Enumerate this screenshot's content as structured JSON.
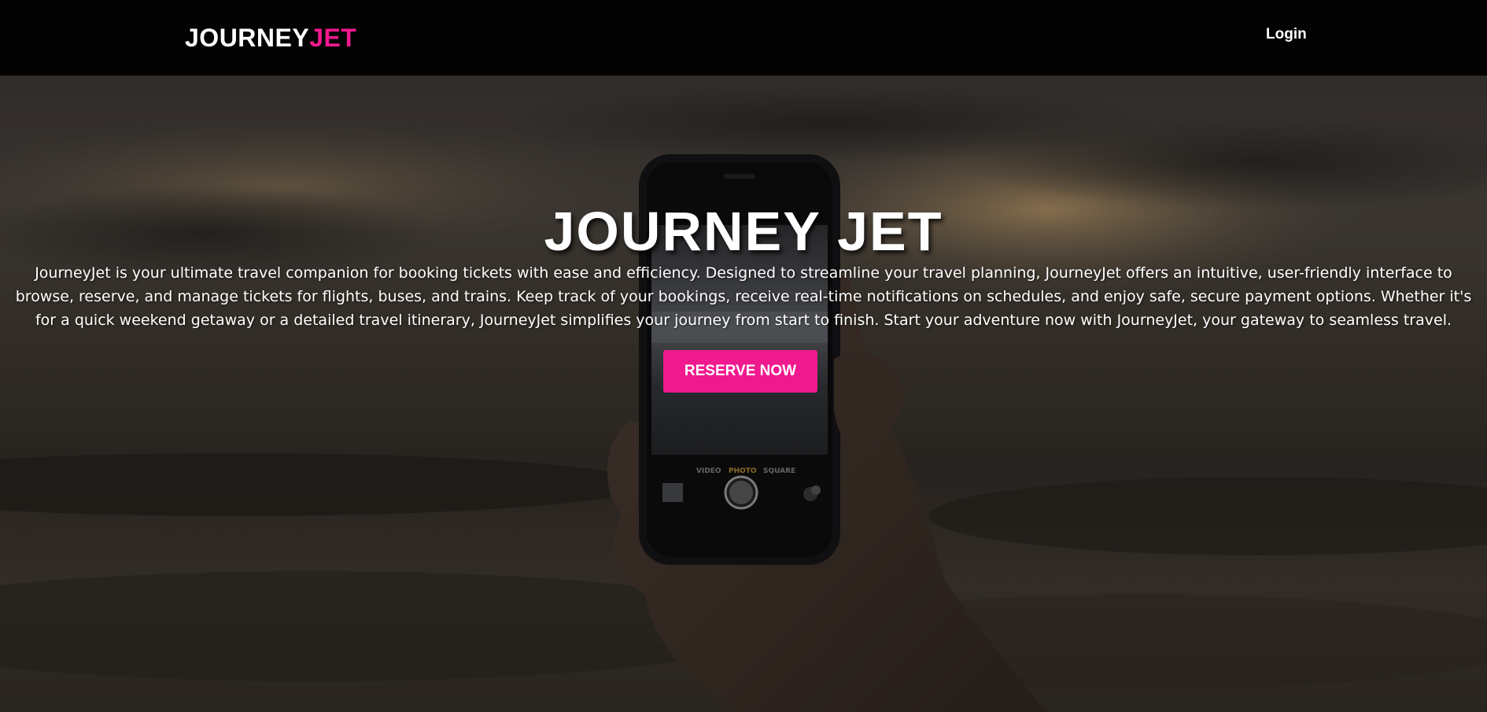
{
  "navbar": {
    "logo_part1": "JOURNEY",
    "logo_part2": "JET",
    "login_label": "Login"
  },
  "hero": {
    "title": "JOURNEY JET",
    "description": "JourneyJet is your ultimate travel companion for booking tickets with ease and efficiency. Designed to streamline your travel planning, JourneyJet offers an intuitive, user-friendly interface to browse, reserve, and manage tickets for flights, buses, and trains. Keep track of your bookings, receive real-time notifications on schedules, and enjoy safe, secure payment options. Whether it's for a quick weekend getaway or a detailed travel itinerary, JourneyJet simplifies your journey from start to finish. Start your adventure now with JourneyJet, your gateway to seamless travel.",
    "cta_label": "RESERVE NOW",
    "camera_modes": [
      "VIDEO",
      "PHOTO",
      "SQUARE"
    ]
  },
  "colors": {
    "accent": "#f0198e",
    "navbar_bg": "#030303",
    "text": "#ffffff"
  }
}
